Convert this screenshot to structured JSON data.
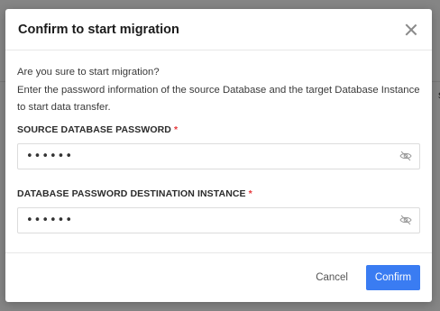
{
  "background": {
    "partial_text": "s"
  },
  "modal": {
    "title": "Confirm to start migration",
    "description_line1": "Are you sure to start migration?",
    "description_line2": "Enter the password information of the source Database and the target Database Instance to start data transfer.",
    "source_password": {
      "label": "SOURCE DATABASE PASSWORD",
      "required_mark": "*",
      "value": "••••••"
    },
    "destination_password": {
      "label": "DATABASE PASSWORD DESTINATION INSTANCE",
      "required_mark": "*",
      "value": "••••••"
    },
    "cancel_label": "Cancel",
    "confirm_label": "Confirm"
  },
  "colors": {
    "primary": "#3a7cf2",
    "required": "#e6373a"
  },
  "icons": {
    "close": "close-icon",
    "password_visibility": "eye-off-icon"
  }
}
